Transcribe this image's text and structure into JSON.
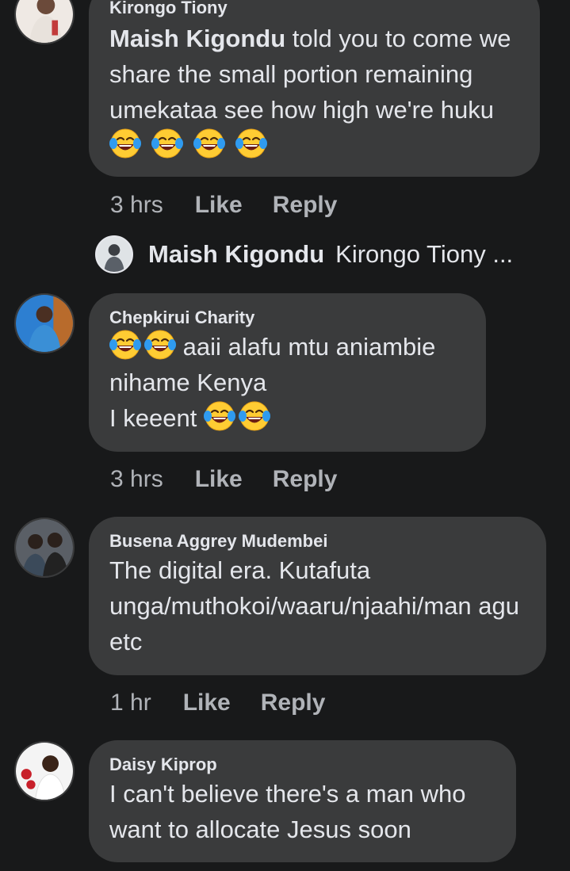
{
  "comments": [
    {
      "author": "Kirongo Tiony",
      "mention": "Maish Kigondu",
      "text": " told you to come we share the small portion remaining umekataa see how high we're huku ",
      "emoji_count": 4,
      "time": "3 hrs",
      "like": "Like",
      "reply": "Reply"
    },
    {
      "author": "Chepkirui Charity",
      "text_line1": " aaii alafu mtu aniambie nihame Kenya",
      "text_line2": "I keeent ",
      "time": "3 hrs",
      "like": "Like",
      "reply": "Reply"
    },
    {
      "author": "Busena Aggrey Mudembei",
      "text": "The digital era. Kutafuta unga/muthokoi/waaru/njaahi/man agu etc",
      "time": "1 hr",
      "like": "Like",
      "reply": "Reply"
    },
    {
      "author": "Daisy Kiprop",
      "text": "I can't believe there's a man who want to allocate Jesus soon"
    }
  ],
  "reply_preview": {
    "author": "Maish Kigondu",
    "text": "Kirongo Tiony ..."
  },
  "emoji_name": "face-with-tears-of-joy",
  "colors": {
    "background": "#18191a",
    "bubble": "#3a3b3c",
    "text": "#e4e6eb",
    "meta": "#b0b3b8"
  }
}
